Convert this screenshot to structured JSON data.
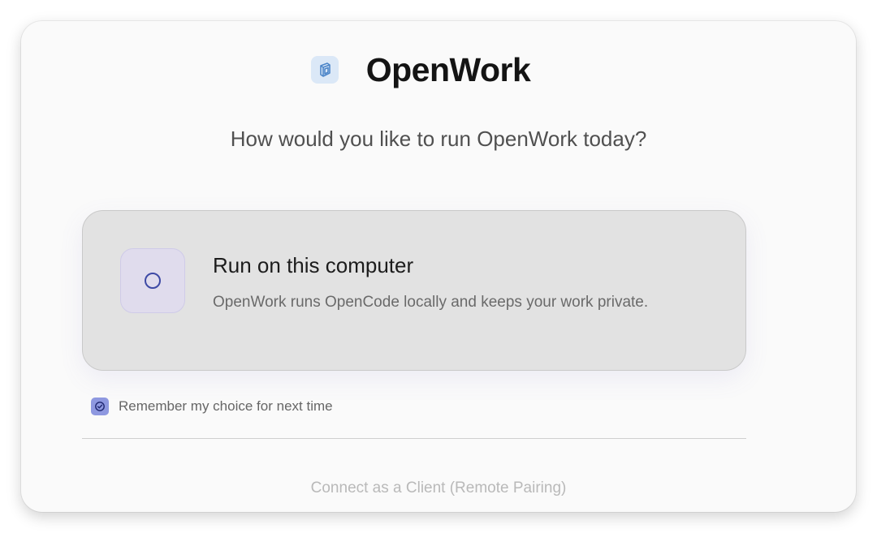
{
  "app": {
    "title": "OpenWork",
    "logo_icon": "openwork-logo-icon"
  },
  "prompt": "How would you like to run OpenWork today?",
  "options": [
    {
      "title": "Run on this computer",
      "description": "OpenWork runs OpenCode locally and keeps your work private.",
      "selected": false
    }
  ],
  "remember": {
    "label": "Remember my choice for next time",
    "checked": true
  },
  "client_link": {
    "label": "Connect as a Client (Remote Pairing)"
  },
  "colors": {
    "accent": "#8e98e0",
    "radio_stroke": "#3e4aa5",
    "card_bg": "#e2e2e2",
    "logo_bg": "#dbe8f7",
    "logo_stroke": "#4d86c9"
  }
}
